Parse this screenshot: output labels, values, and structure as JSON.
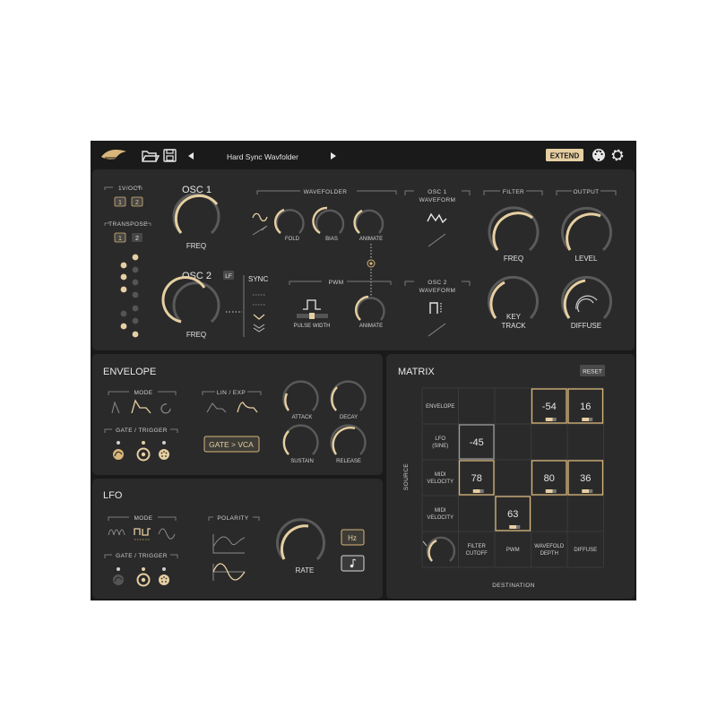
{
  "topbar": {
    "preset_name": "Hard Sync Wavfolder",
    "prev_icon": "triangle-left-icon",
    "next_icon": "triangle-right-icon",
    "extend_label": "EXTEND",
    "logo_icon": "bird-logo-icon",
    "folder_icon": "folder-icon",
    "save_icon": "floppy-icon",
    "midi_icon": "midi-icon",
    "settings_icon": "gear-icon"
  },
  "osc": {
    "voct_label": "1V/OCT",
    "voct_buttons": [
      "1",
      "2"
    ],
    "transpose_label": "TRANSPOSE",
    "transpose_buttons": [
      "1",
      "2"
    ],
    "osc1_title": "OSC 1",
    "osc1_freq_label": "FREQ",
    "osc2_title": "OSC 2",
    "osc2_lf_label": "LF",
    "osc2_freq_label": "FREQ",
    "sync_label": "SYNC",
    "wavefolder_label": "WAVEFOLDER",
    "fold_label": "FOLD",
    "bias_label": "BIAS",
    "animate_label": "ANIMATE",
    "pwm_label": "PWM",
    "pulse_width_label": "PULSE WIDTH",
    "pwm_animate_label": "ANIMATE",
    "osc1_waveform_label": [
      "OSC 1",
      "WAVEFORM"
    ],
    "osc2_waveform_label": [
      "OSC 2",
      "WAVEFORM"
    ],
    "filter_label": "FILTER",
    "filter_freq_label": "FREQ",
    "key_track_label": [
      "KEY",
      "TRACK"
    ],
    "output_label": "OUTPUT",
    "level_label": "LEVEL",
    "diffuse_label": "DIFFUSE"
  },
  "envelope": {
    "title": "ENVELOPE",
    "mode_label": "MODE",
    "lin_exp_label": "LIN / EXP",
    "gate_trigger_label": "GATE / TRIGGER",
    "gate_vca_label": "GATE > VCA",
    "attack_label": "ATTACK",
    "decay_label": "DECAY",
    "sustain_label": "SUSTAIN",
    "release_label": "RELEASE"
  },
  "lfo": {
    "title": "LFO",
    "mode_label": "MODE",
    "polarity_label": "POLARITY",
    "gate_trigger_label": "GATE / TRIGGER",
    "rate_label": "RATE",
    "hz_label": "Hz",
    "note_icon": "music-note-icon"
  },
  "matrix": {
    "title": "MATRIX",
    "reset_label": "RESET",
    "source_axis_label": "SOURCE",
    "destination_axis_label": "DESTINATION",
    "sources": [
      [
        "ENVELOPE"
      ],
      [
        "LFO",
        "(SINE)"
      ],
      [
        "MIDI",
        "VELOCITY"
      ],
      [
        "MIDI",
        "VELOCITY"
      ]
    ],
    "destinations": [
      [
        "FILTER",
        "CUTOFF"
      ],
      [
        "PWM"
      ],
      [
        "WAVEFOLD",
        "DEPTH"
      ],
      [
        "DIFFUSE"
      ]
    ],
    "cells": [
      {
        "row": 0,
        "col": 2,
        "value": "-54"
      },
      {
        "row": 0,
        "col": 3,
        "value": "16"
      },
      {
        "row": 1,
        "col": 0,
        "value": "-45"
      },
      {
        "row": 2,
        "col": 0,
        "value": "78"
      },
      {
        "row": 2,
        "col": 2,
        "value": "80"
      },
      {
        "row": 2,
        "col": 3,
        "value": "36"
      },
      {
        "row": 3,
        "col": 1,
        "value": "63"
      }
    ]
  },
  "colors": {
    "panel": "#2a2a2a",
    "frame": "#1a1a1a",
    "accent": "#d8b57a",
    "track": "#5a5a5a"
  }
}
